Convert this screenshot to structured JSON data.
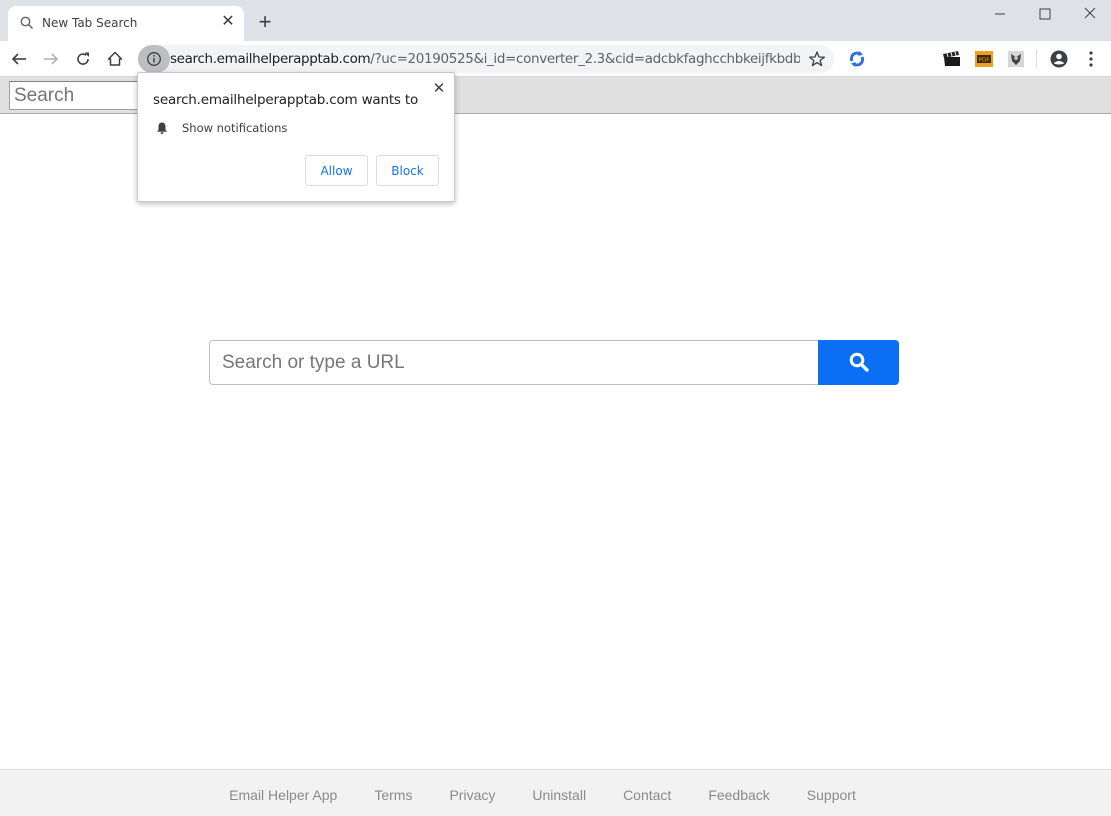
{
  "browser": {
    "tab": {
      "title": "New Tab Search",
      "icon": "search-icon"
    },
    "new_tab_label": "+",
    "window_controls": [
      "minimize",
      "maximize",
      "close"
    ],
    "address": {
      "host": "search.emailhelperapptab.com",
      "path": "/?uc=20190525&i_id=converter_2.3&cid=adcbkfaghcchbkeijfkbdbahi..."
    },
    "extensions": [
      "sync-extension-icon",
      "clapperboard-extension-icon",
      "pdf-extension-icon",
      "crest-extension-icon"
    ]
  },
  "pagebar": {
    "search_placeholder": "Search"
  },
  "popup": {
    "title": "search.emailhelperapptab.com wants to",
    "permission": "Show notifications",
    "allow_label": "Allow",
    "block_label": "Block"
  },
  "main": {
    "search_placeholder": "Search or type a URL",
    "accent_color": "#0a6ff5"
  },
  "footer": {
    "links": [
      "Email Helper App",
      "Terms",
      "Privacy",
      "Uninstall",
      "Contact",
      "Feedback",
      "Support"
    ]
  }
}
